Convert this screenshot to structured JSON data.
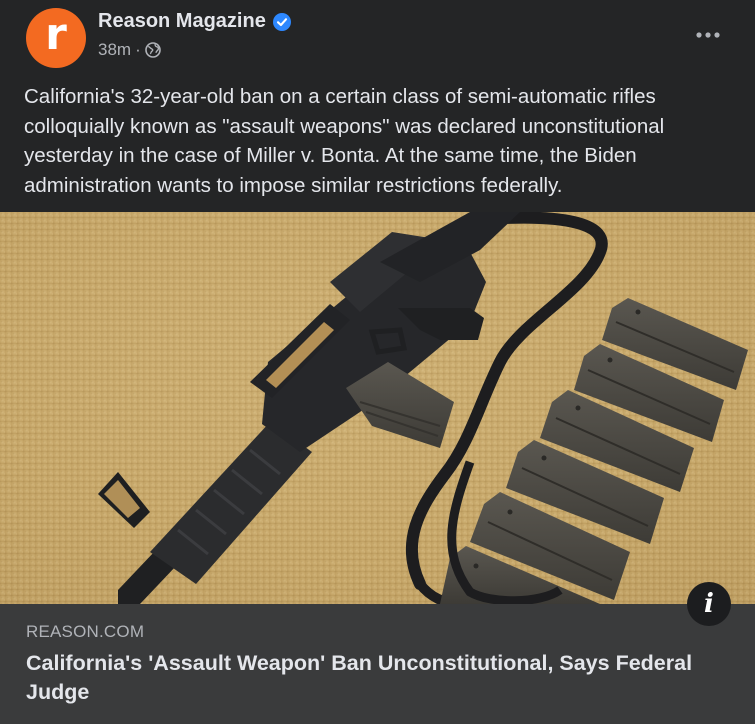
{
  "post": {
    "author": {
      "avatar_letter": "r",
      "name": "Reason Magazine",
      "verified": true
    },
    "time": "38m",
    "separator": "·",
    "audience_icon": "globe-icon",
    "more_icon": "more-options-icon",
    "caption": "California's 32-year-old ban on a certain class of semi-automatic rifles colloquially known as \"assault weapons\" was declared unconstitutional yesterday in the case of Miller v. Bonta. At the same time, the Biden administration wants to impose similar restrictions federally.",
    "link": {
      "domain": "REASON.COM",
      "title": "California's 'Assault Weapon' Ban Unconstitutional, Says Federal Judge"
    },
    "info_glyph": "i"
  },
  "colors": {
    "card_background": "#242526",
    "link_footer_background": "#3a3b3c",
    "avatar_brand": "#f36a21",
    "verified_badge": "#2d88ff",
    "primary_text": "#e4e6eb",
    "secondary_text": "#b0b3b8",
    "carpet": "#c9ab6e",
    "rifle": "#2a2b2d",
    "magazine": "#4a4741"
  }
}
